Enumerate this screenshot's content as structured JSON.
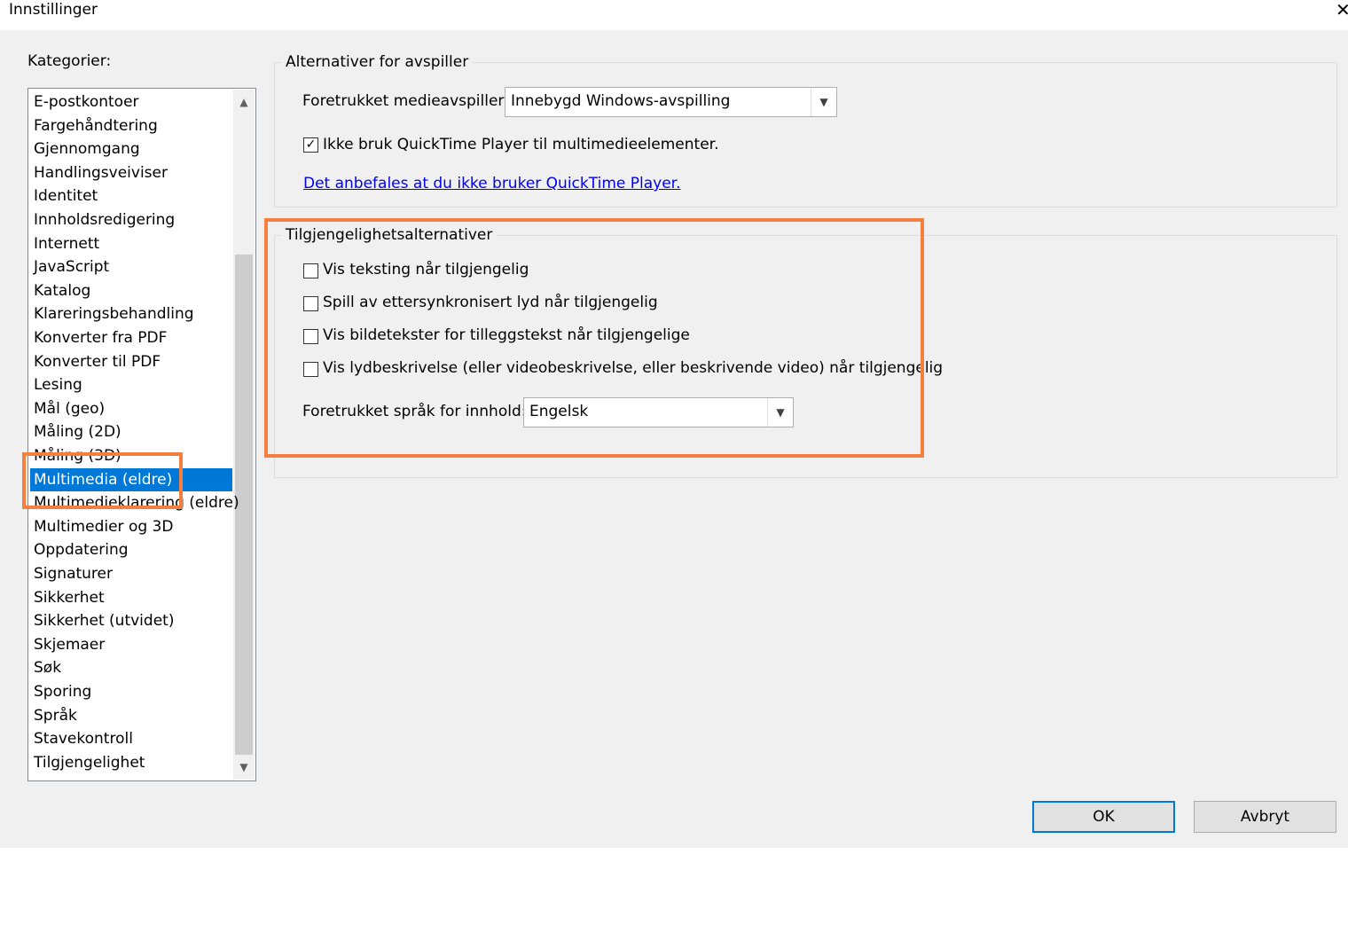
{
  "window": {
    "title": "Innstillinger",
    "close_glyph": "✕"
  },
  "categories": {
    "label": "Kategorier:",
    "items": [
      "E-postkontoer",
      "Fargehåndtering",
      "Gjennomgang",
      "Handlingsveiviser",
      "Identitet",
      "Innholdsredigering",
      "Internett",
      "JavaScript",
      "Katalog",
      "Klareringsbehandling",
      "Konverter fra PDF",
      "Konverter til PDF",
      "Lesing",
      "Mål (geo)",
      "Måling (2D)",
      "Måling (3D)",
      "Multimedia (eldre)",
      "Multimedieklarering (eldre)",
      "Multimedier og 3D",
      "Oppdatering",
      "Signaturer",
      "Sikkerhet",
      "Sikkerhet (utvidet)",
      "Skjemaer",
      "Søk",
      "Sporing",
      "Språk",
      "Stavekontroll",
      "Tilgjengelighet"
    ],
    "selected": "Multimedia (eldre)"
  },
  "player": {
    "group_title": "Alternativer for avspiller",
    "media_player_label": "Foretrukket medieavspiller:",
    "media_player_value": "Innebygd Windows-avspilling",
    "no_quicktime_label": "Ikke bruk QuickTime Player til multimedieelementer.",
    "no_quicktime_checked": true,
    "link_text": "Det anbefales at du ikke bruker QuickTime Player."
  },
  "accessibility": {
    "group_title": "Tilgjengelighetsalternativer",
    "options": [
      {
        "label": "Vis teksting når tilgjengelig",
        "checked": false
      },
      {
        "label": "Spill av ettersynkronisert lyd når tilgjengelig",
        "checked": false
      },
      {
        "label": "Vis bildetekster for tilleggstekst når tilgjengelige",
        "checked": false
      },
      {
        "label": "Vis lydbeskrivelse (eller videobeskrivelse, eller beskrivende video) når tilgjengelig",
        "checked": false
      }
    ],
    "language_label": "Foretrukket språk for innhold:",
    "language_value": "Engelsk"
  },
  "buttons": {
    "ok": "OK",
    "cancel": "Avbryt"
  },
  "icons": {
    "chevron_down": "chevron-down-icon",
    "chevron_up": "chevron-up-icon",
    "check": "check-icon"
  },
  "colors": {
    "selection": "#0078d7",
    "highlight": "#f47f3f",
    "link": "#0000ee"
  }
}
